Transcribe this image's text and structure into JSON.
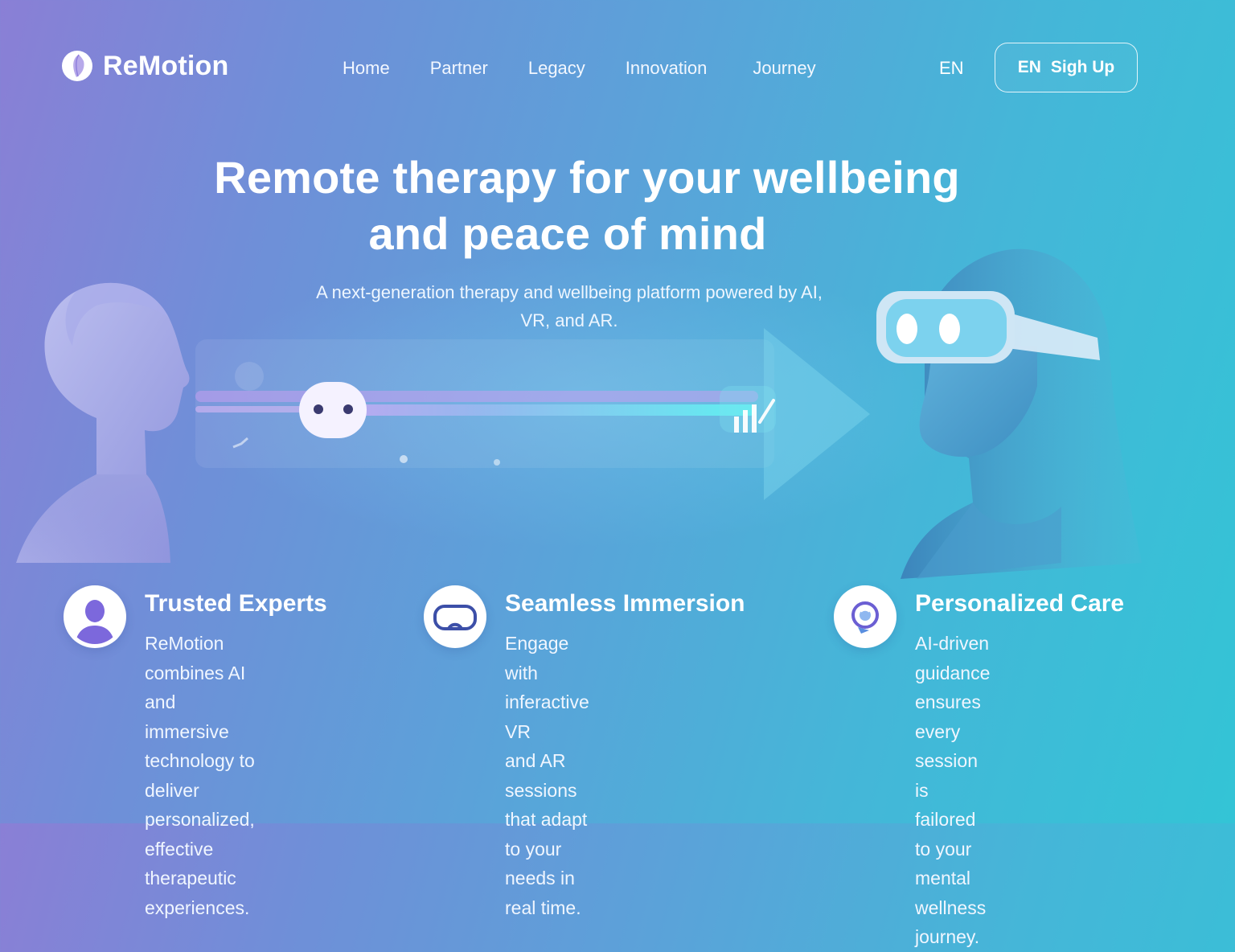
{
  "brand": {
    "name": "ReMotion"
  },
  "nav": {
    "items": [
      {
        "label": "Home"
      },
      {
        "label": "Partner"
      },
      {
        "label": "Legacy"
      },
      {
        "label": "Innovation"
      },
      {
        "label": "Journey"
      }
    ],
    "language": "EN",
    "signup": {
      "prefix": "EN",
      "label": "Sigh Up"
    }
  },
  "hero": {
    "title_line1": "Remote therapy for your wellbeing",
    "title_line2": "and peace of mind",
    "subtitle_line1": "A next-generation therapy and wellbeing platform powered by AI,",
    "subtitle_line2": "VR, and AR."
  },
  "features": [
    {
      "icon": "person-icon",
      "title": "Trusted Experts",
      "lines": [
        "ReMotion combines AI",
        "and immersive",
        "technology to deliver",
        "personalized, effective",
        "therapeutic experiences."
      ]
    },
    {
      "icon": "vr-headset-icon",
      "title": "Seamless Immersion",
      "lines": [
        "Engage with inferactive VR",
        "and AR sessions that adapt",
        "to your needs in real time."
      ]
    },
    {
      "icon": "care-chat-icon",
      "title": "Personalized Care",
      "lines": [
        "AI-driven guidance",
        "ensures every session",
        "is failored to your",
        "mental wellness journey."
      ]
    }
  ],
  "colors": {
    "gradient_start": "#8a7fd6",
    "gradient_end": "#33c4d6",
    "accent_purple": "#6b5fd3",
    "beam_cyan": "#5ef0f0"
  }
}
